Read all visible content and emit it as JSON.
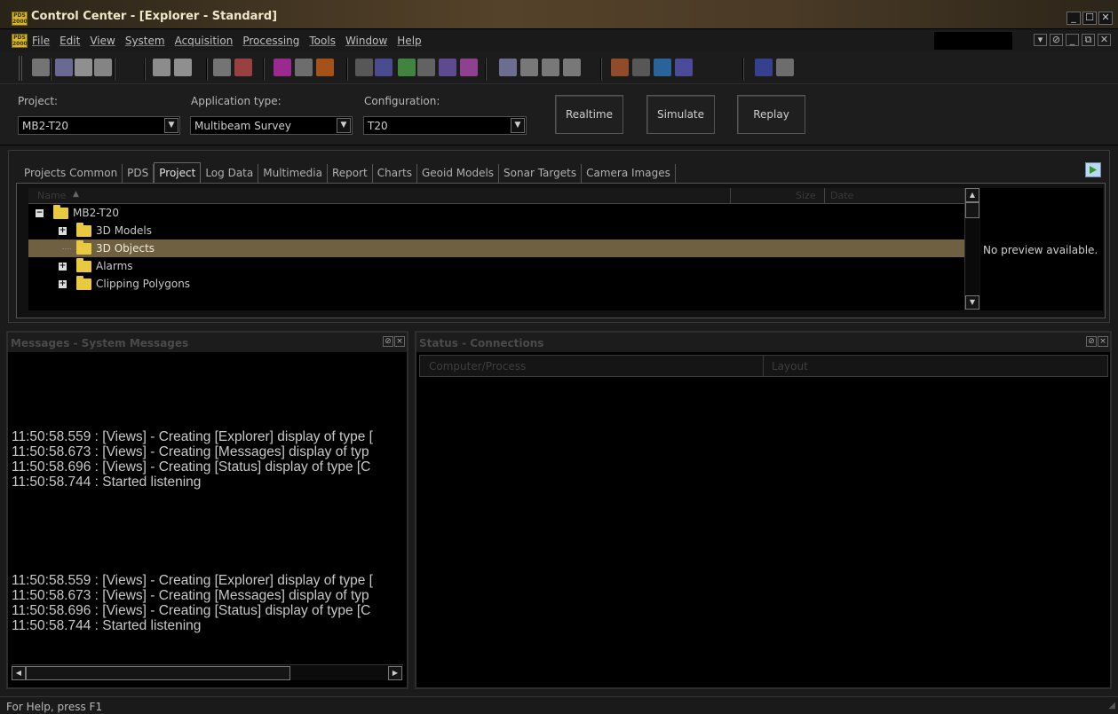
{
  "window": {
    "title": "Control Center - [Explorer - Standard]",
    "logo_text": "PDS 2000",
    "controls": [
      "_",
      "☐",
      "✕"
    ]
  },
  "menu": {
    "items": [
      "File",
      "Edit",
      "View",
      "System",
      "Acquisition",
      "Processing",
      "Tools",
      "Window",
      "Help"
    ],
    "mdi_controls": [
      "▾",
      "⊘",
      "_",
      "⧉",
      "✕"
    ]
  },
  "toolbar": {
    "icons": [
      {
        "name": "pen-icon",
        "color": "#9a9a9a"
      },
      {
        "name": "vessel-display-icon",
        "color": "#8a8ac8"
      },
      {
        "name": "edit-tool-icon",
        "color": "#c0c0c0"
      },
      {
        "name": "list-view-icon",
        "color": "#b0b0b0"
      },
      {
        "name": "clock-icon",
        "color": "#bcbcbc"
      },
      {
        "name": "satellite-icon",
        "color": "#c0c0c0"
      },
      {
        "name": "settings-gear-icon",
        "color": "#9a9a9a"
      },
      {
        "name": "import-icon",
        "color": "#d05050"
      },
      {
        "name": "record-icon",
        "color": "#d030c0"
      },
      {
        "name": "monitor-icon",
        "color": "#909090"
      },
      {
        "name": "refresh-icon",
        "color": "#e06a1a"
      },
      {
        "name": "grid-icon",
        "color": "#707070"
      },
      {
        "name": "draw-icon",
        "color": "#6060c0"
      },
      {
        "name": "add-layer-icon",
        "color": "#50b050"
      },
      {
        "name": "image-icon",
        "color": "#808080"
      },
      {
        "name": "chart-edit-icon",
        "color": "#7a60c0"
      },
      {
        "name": "bar-chart-icon",
        "color": "#c050c0"
      },
      {
        "name": "tools-icon",
        "color": "#9090c0"
      },
      {
        "name": "print-icon",
        "color": "#a0a0a0"
      },
      {
        "name": "export-icon",
        "color": "#a0a0a0"
      },
      {
        "name": "report-icon",
        "color": "#a0a0a0"
      },
      {
        "name": "photo-icon",
        "color": "#c06030"
      },
      {
        "name": "camera-image-icon",
        "color": "#707070"
      },
      {
        "name": "sonar-icon",
        "color": "#3080d0"
      },
      {
        "name": "target-icon",
        "color": "#6060d0"
      },
      {
        "name": "keyboard-icon",
        "color": "#4050c0"
      },
      {
        "name": "list-icon",
        "color": "#909090"
      }
    ]
  },
  "config": {
    "project_label": "Project:",
    "project_value": "MB2-T20",
    "apptype_label": "Application type:",
    "apptype_value": "Multibeam Survey",
    "configuration_label": "Configuration:",
    "configuration_value": "T20",
    "realtime_label": "Realtime",
    "simulate_label": "Simulate",
    "replay_label": "Replay"
  },
  "explorer": {
    "tabs": [
      "Projects Common",
      "PDS",
      "Project",
      "Log Data",
      "Multimedia",
      "Report",
      "Charts",
      "Geoid Models",
      "Sonar Targets",
      "Camera Images"
    ],
    "active_tab": "Project",
    "columns": {
      "name": "Name",
      "size": "Size",
      "date": "Date"
    },
    "tree": [
      {
        "label": "MB2-T20",
        "level": 0,
        "expander": "−",
        "open": true,
        "selected": false
      },
      {
        "label": "3D Models",
        "level": 1,
        "expander": "+",
        "open": false,
        "selected": false
      },
      {
        "label": "3D Objects",
        "level": 1,
        "expander": "",
        "open": false,
        "selected": true
      },
      {
        "label": "Alarms",
        "level": 1,
        "expander": "+",
        "open": false,
        "selected": false
      },
      {
        "label": "Clipping Polygons",
        "level": 1,
        "expander": "+",
        "open": false,
        "selected": false
      }
    ],
    "preview_text": "No preview available."
  },
  "messages": {
    "title": "Messages - System Messages",
    "block_a": [
      "11:50:58.559 : [Views] - Creating [Explorer] display of type [",
      "11:50:58.673 : [Views] - Creating [Messages] display of typ",
      "11:50:58.696 : [Views] - Creating [Status] display of type [C",
      "11:50:58.744 : Started listening"
    ],
    "block_b": [
      "11:50:58.559 : [Views] - Creating [Explorer] display of type [",
      "11:50:58.673 : [Views] - Creating [Messages] display of typ",
      "11:50:58.696 : [Views] - Creating [Status] display of type [C",
      "11:50:58.744 : Started listening"
    ]
  },
  "status_panel": {
    "title": "Status - Connections",
    "col1": "Computer/Process",
    "col2": "Layout"
  },
  "statusbar": {
    "text": "For Help, press F1"
  },
  "colors": {
    "selection": "#6e6040",
    "folder": "#e9c93f",
    "title_gradient": "#55422a"
  }
}
